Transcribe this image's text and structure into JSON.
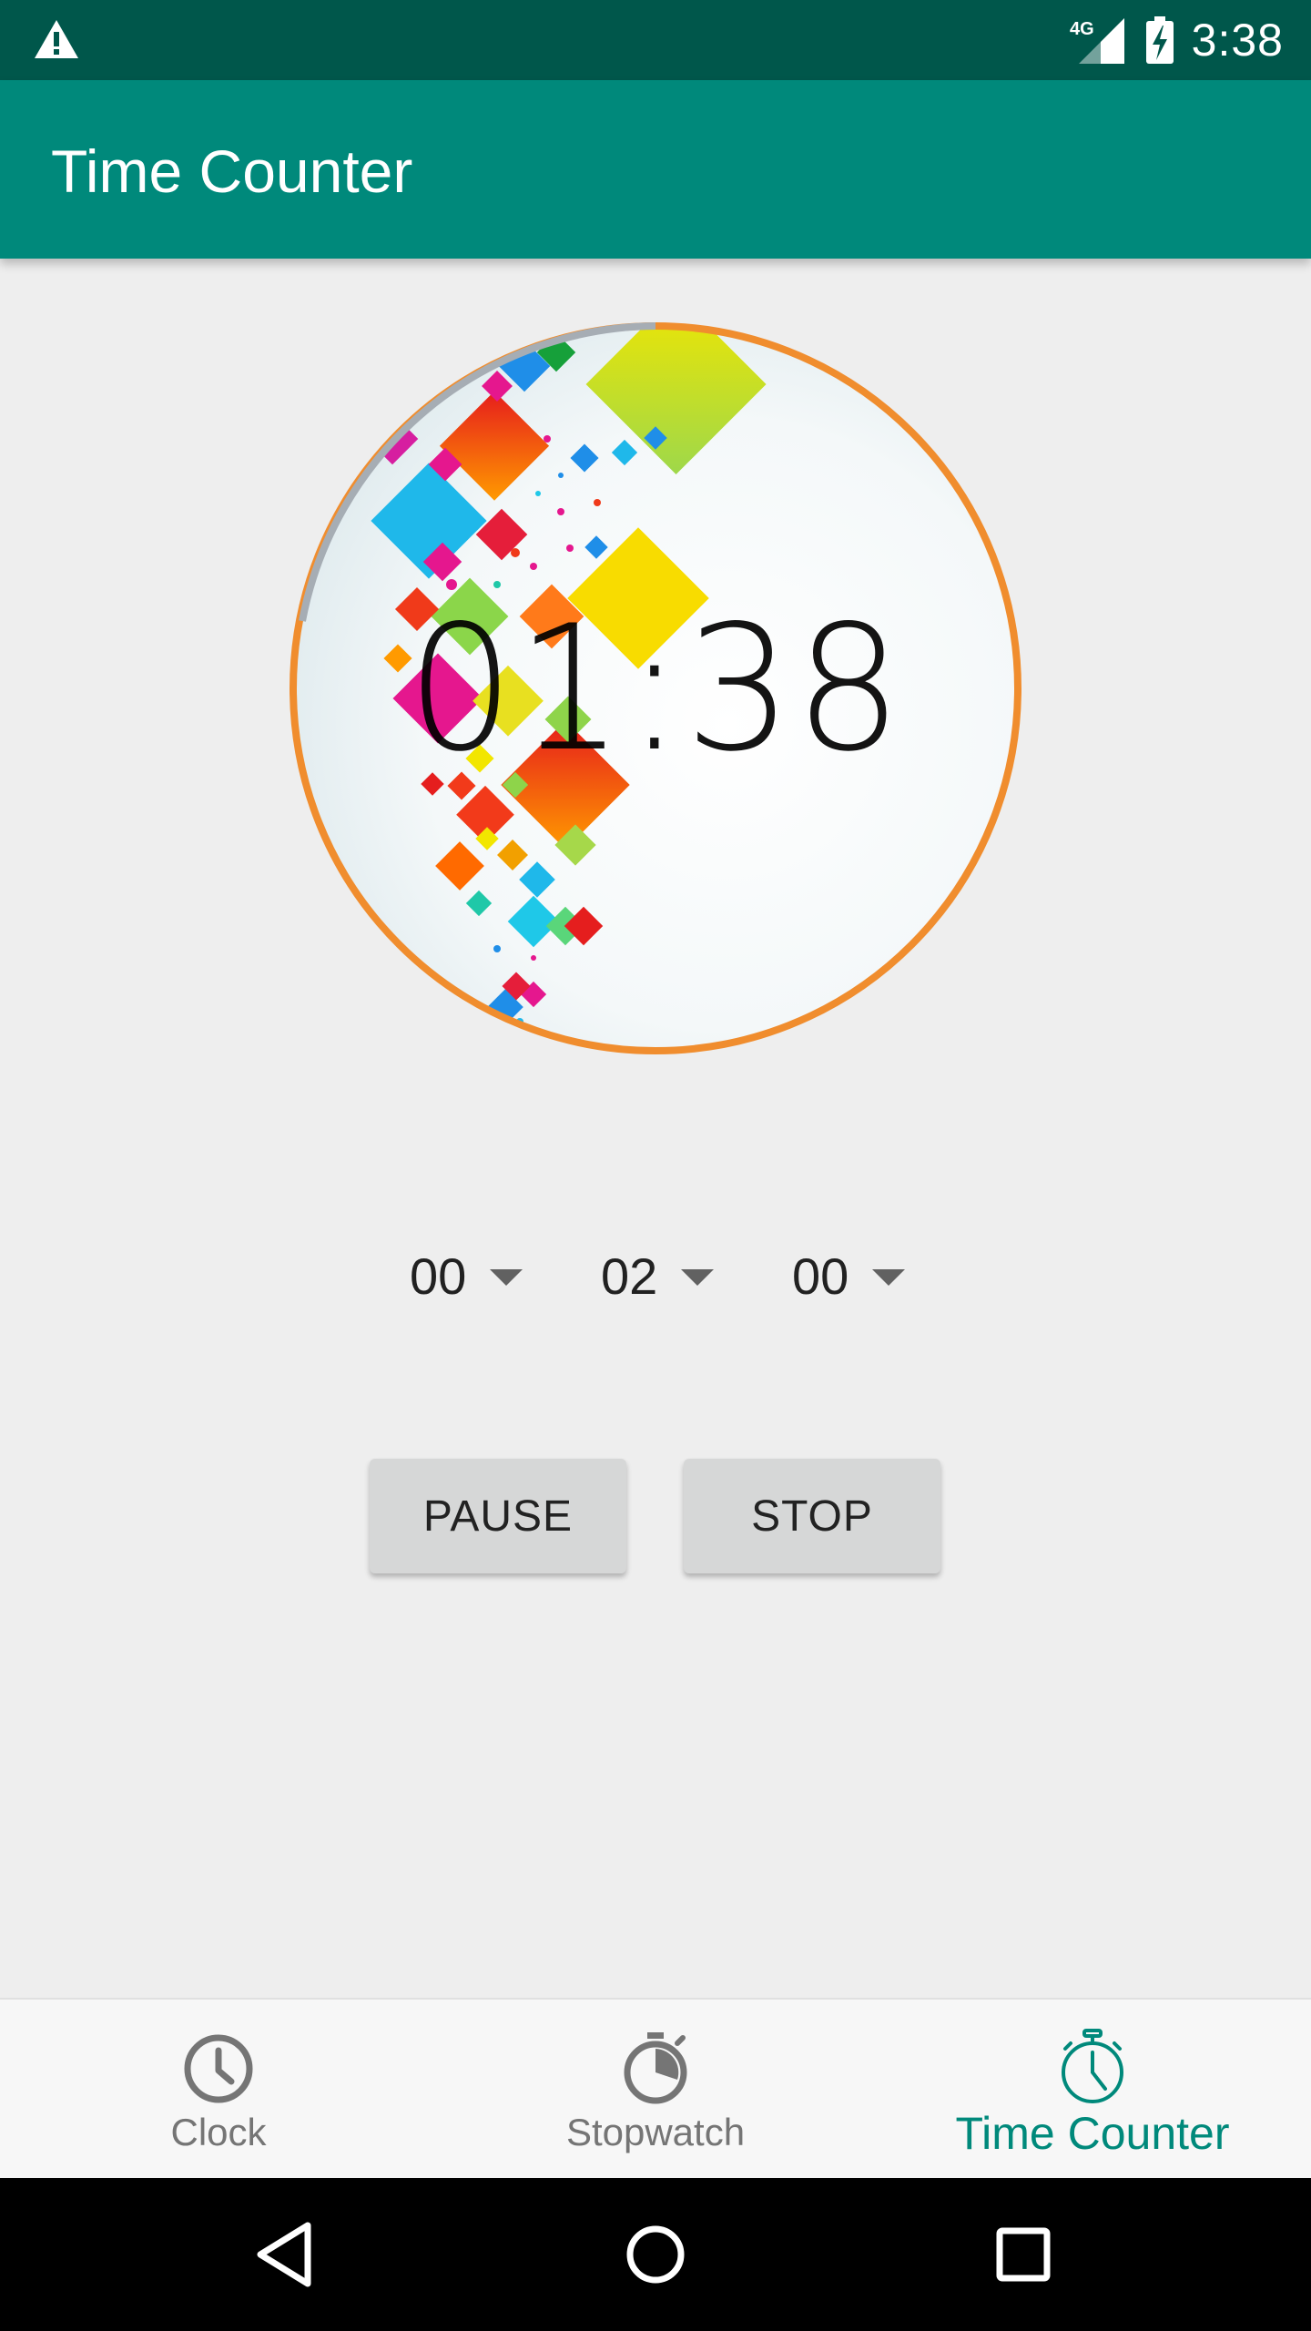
{
  "status_bar": {
    "time": "3:38",
    "network": "4G",
    "icons": [
      "warning-icon",
      "signal-4g-icon",
      "battery-charging-icon"
    ]
  },
  "app_bar": {
    "title": "Time Counter"
  },
  "timer": {
    "display": "01:38"
  },
  "pickers": {
    "hours": "00",
    "minutes": "02",
    "seconds": "00"
  },
  "buttons": {
    "pause": "PAUSE",
    "stop": "STOP"
  },
  "bottom_nav": {
    "items": [
      {
        "label": "Clock",
        "icon": "clock-icon",
        "active": false
      },
      {
        "label": "Stopwatch",
        "icon": "stopwatch-icon",
        "active": false
      },
      {
        "label": "Time Counter",
        "icon": "timer-icon",
        "active": true
      }
    ]
  },
  "colors": {
    "status_bar": "#00574b",
    "app_bar": "#00897b",
    "accent": "#00897b",
    "ring": "#f08d2e",
    "background": "#eeeeee"
  }
}
